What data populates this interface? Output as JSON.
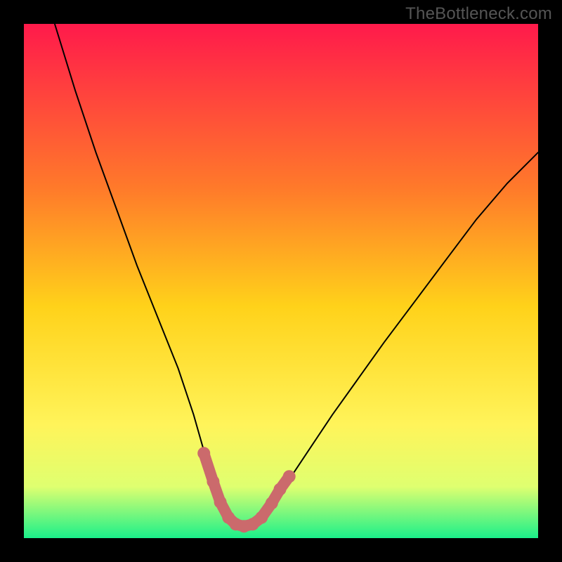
{
  "watermark": "TheBottleneck.com",
  "colors": {
    "background": "#000000",
    "gradient_top": "#ff1a4b",
    "gradient_mid1": "#ff7a2a",
    "gradient_mid2": "#ffd21a",
    "gradient_mid3": "#fff45a",
    "gradient_mid4": "#dfff70",
    "gradient_bottom": "#1bf08a",
    "curve": "#000000",
    "marker": "#cb6a6c"
  },
  "chart_data": {
    "type": "line",
    "title": "",
    "xlabel": "",
    "ylabel": "",
    "xlim": [
      0,
      100
    ],
    "ylim": [
      0,
      100
    ],
    "series": [
      {
        "name": "bottleneck-curve",
        "x": [
          6,
          10,
          14,
          18,
          22,
          26,
          30,
          33,
          35,
          37,
          38.5,
          40,
          41.5,
          43,
          45,
          47,
          49,
          52,
          56,
          60,
          65,
          70,
          76,
          82,
          88,
          94,
          100
        ],
        "y": [
          100,
          87,
          75,
          64,
          53,
          43,
          33,
          24,
          17,
          11,
          7,
          4,
          2.5,
          2,
          2.5,
          4,
          7,
          12,
          18,
          24,
          31,
          38,
          46,
          54,
          62,
          69,
          75
        ]
      }
    ],
    "markers": {
      "name": "highlight-points",
      "x": [
        35.0,
        36.8,
        38.2,
        39.8,
        41.2,
        42.8,
        44.5,
        46.2,
        48.2,
        49.8,
        51.6
      ],
      "y": [
        16.5,
        11.0,
        7.0,
        4.0,
        2.7,
        2.3,
        2.7,
        4.0,
        6.8,
        9.5,
        12.0
      ]
    }
  }
}
